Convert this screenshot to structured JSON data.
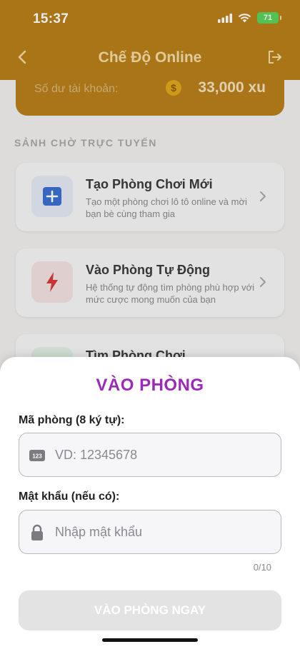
{
  "status_bar": {
    "time": "15:37",
    "battery": "71"
  },
  "nav": {
    "title": "Chế Độ Online",
    "back_icon": "chevron-left-icon",
    "logout_icon": "logout-icon"
  },
  "balance": {
    "label": "Số dư tài khoản:",
    "coin_symbol": "$",
    "value": "33,000 xu"
  },
  "lobby": {
    "section_title": "SẢNH CHỜ TRỰC TUYẾN",
    "items": [
      {
        "title": "Tạo Phòng Chơi Mới",
        "description": "Tạo một phòng chơi lô tô online và mời bạn bè cùng tham gia",
        "icon": "plus-icon",
        "icon_color": "#3b6fd1",
        "icon_bg": "#e3e9f4"
      },
      {
        "title": "Vào Phòng Tự Động",
        "description": "Hệ thống tự động tìm phòng phù hợp với mức cược mong muốn của bạn",
        "icon": "lightning-icon",
        "icon_color": "#d83a3a",
        "icon_bg": "#f4e1e1"
      },
      {
        "title": "Tìm Phòng Chơi",
        "description": "",
        "icon": "search-icon",
        "icon_color": "#3a9b4a",
        "icon_bg": "#e1efe3"
      }
    ]
  },
  "sheet": {
    "title": "VÀO PHÒNG",
    "room_code_label": "Mã phòng (8 ký tự):",
    "room_code_placeholder": "VD: 12345678",
    "room_code_value": "",
    "room_code_icon": "number-pad-icon",
    "password_label": "Mật khẩu (nếu có):",
    "password_placeholder": "Nhập mật khẩu",
    "password_value": "",
    "password_icon": "lock-icon",
    "password_counter": "0/10",
    "submit_label": "VÀO PHÒNG NGAY"
  },
  "colors": {
    "header": "#b97f1a",
    "sheet_title": "#9b2ab8",
    "submit_disabled": "#e3e3e3"
  }
}
